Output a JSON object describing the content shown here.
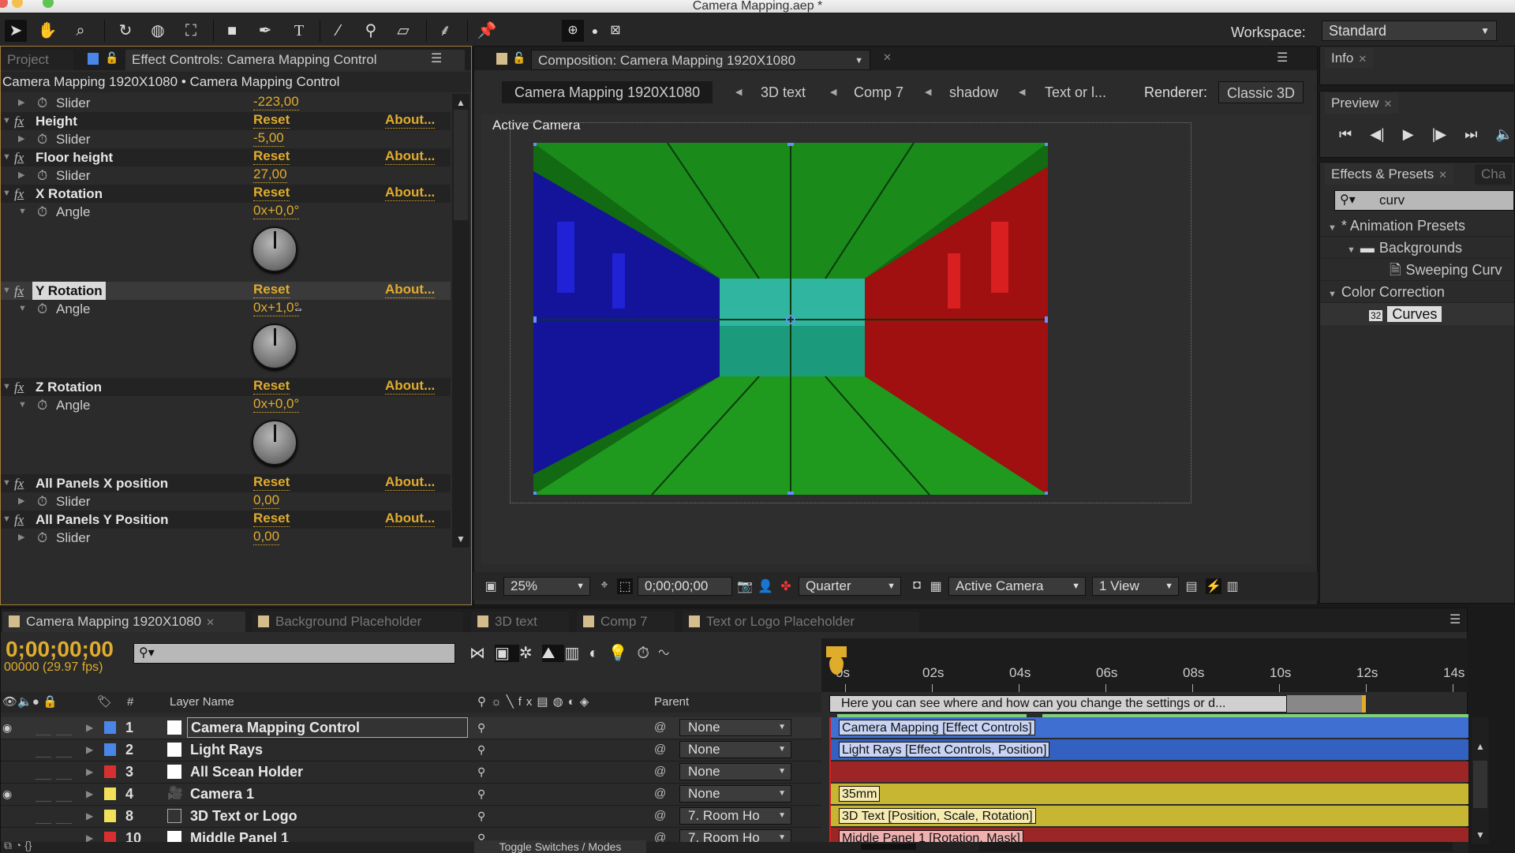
{
  "window": {
    "title": "Camera Mapping.aep *"
  },
  "toolbar": {
    "tools": [
      "selection-tool",
      "hand-tool",
      "zoom-tool",
      "rotation-tool",
      "orbit-camera-tool",
      "pan-behind-tool",
      "rectangle-tool",
      "pen-tool",
      "type-tool",
      "brush-tool",
      "clone-stamp-tool",
      "eraser-tool",
      "roto-brush-tool",
      "puppet-pin-tool"
    ],
    "workspace_label": "Workspace:",
    "workspace_value": "Standard"
  },
  "project_tab": "Project",
  "effect_controls": {
    "tab": "Effect Controls: Camera Mapping Control",
    "breadcrumb": "Camera Mapping 1920X1080 • Camera Mapping Control",
    "reset_label": "Reset",
    "about_label": "About...",
    "rows": [
      {
        "type": "param",
        "name": "Slider",
        "value": "-223,00"
      },
      {
        "type": "effect",
        "name": "Height"
      },
      {
        "type": "param",
        "name": "Slider",
        "value": "-5,00"
      },
      {
        "type": "effect",
        "name": "Floor height"
      },
      {
        "type": "param",
        "name": "Slider",
        "value": "27,00"
      },
      {
        "type": "effect",
        "name": "X Rotation"
      },
      {
        "type": "param",
        "name": "Angle",
        "value": "0x+0,0°"
      },
      {
        "type": "effect",
        "name": "Y Rotation"
      },
      {
        "type": "param",
        "name": "Angle",
        "value": "0x+1,0°"
      },
      {
        "type": "effect",
        "name": "Z Rotation"
      },
      {
        "type": "param",
        "name": "Angle",
        "value": "0x+0,0°"
      },
      {
        "type": "effect",
        "name": "All Panels X position"
      },
      {
        "type": "param",
        "name": "Slider",
        "value": "0,00"
      },
      {
        "type": "effect",
        "name": "All Panels Y Position"
      },
      {
        "type": "param",
        "name": "Slider",
        "value": "0,00"
      }
    ]
  },
  "composition": {
    "tab": "Composition: Camera Mapping 1920X1080",
    "breadcrumbs": [
      "Camera Mapping 1920X1080",
      "3D text",
      "Comp 7",
      "shadow",
      "Text or l..."
    ],
    "renderer_label": "Renderer:",
    "renderer_value": "Classic 3D",
    "view_label": "Active Camera",
    "zoom": "25%",
    "timecode": "0;00;00;00",
    "resolution": "Quarter",
    "camera": "Active Camera",
    "views": "1 View"
  },
  "info_panel": {
    "tab": "Info"
  },
  "preview_panel": {
    "tab": "Preview"
  },
  "effects_presets": {
    "tab": "Effects & Presets",
    "tab2": "Cha",
    "search_value": "curv",
    "tree": [
      {
        "label": "* Animation Presets",
        "level": 0,
        "kind": "group"
      },
      {
        "label": "Backgrounds",
        "level": 1,
        "kind": "folder"
      },
      {
        "label": "Sweeping Curv",
        "level": 2,
        "kind": "preset"
      },
      {
        "label": "Color Correction",
        "level": 0,
        "kind": "group"
      },
      {
        "label": "Curves",
        "level": 1,
        "kind": "effect",
        "selected": true
      }
    ]
  },
  "timeline": {
    "tabs": [
      "Camera Mapping 1920X1080",
      "Background Placeholder",
      "3D text",
      "Comp 7",
      "Text or Logo Placeholder"
    ],
    "timecode": "0;00;00;00",
    "frame_info": "00000 (29.97 fps)",
    "col_hash": "#",
    "col_layer_name": "Layer Name",
    "col_parent": "Parent",
    "ruler": [
      "0s",
      "02s",
      "04s",
      "06s",
      "08s",
      "10s",
      "12s",
      "14s"
    ],
    "comment_marker": "Here you can see where and how can you change the settings or d...",
    "toggle_label": "Toggle Switches / Modes",
    "layers": [
      {
        "idx": "1",
        "name": "Camera Mapping Control",
        "label_color": "#4a86e8",
        "parent": "None",
        "bar_label": "Camera Mapping [Effect Controls]",
        "bar_color": "#3f6fd1",
        "icon": "solid",
        "selected": true
      },
      {
        "idx": "2",
        "name": "Light Rays",
        "label_color": "#4a86e8",
        "parent": "None",
        "bar_label": "Light Rays [Effect Controls, Position]",
        "bar_color": "#3361c2",
        "icon": "solid"
      },
      {
        "idx": "3",
        "name": "All Scean Holder",
        "label_color": "#d83030",
        "parent": "None",
        "bar_label": "",
        "bar_color": "#9c2626",
        "icon": "solid"
      },
      {
        "idx": "4",
        "name": "Camera 1",
        "label_color": "#f2e05a",
        "parent": "None",
        "bar_label": "35mm",
        "bar_color": "#c7b632",
        "icon": "camera"
      },
      {
        "idx": "8",
        "name": "3D Text or Logo",
        "label_color": "#f2e05a",
        "parent": "7. Room Ho",
        "bar_label": "3D Text [Position, Scale, Rotation]",
        "bar_color": "#c7b632",
        "icon": "comp"
      },
      {
        "idx": "10",
        "name": "Middle Panel 1",
        "label_color": "#d83030",
        "parent": "7. Room Ho",
        "bar_label": "Middle Panel 1 [Rotation, Mask]",
        "bar_color": "#9c2626",
        "icon": "solid"
      }
    ]
  },
  "colors": {
    "accent": "#e0ac2c",
    "panel_bg": "#2b2b2b",
    "wall_left": "#1414a0",
    "wall_right": "#a01010",
    "floor": "#1e8a1e",
    "back": "#2fb5a0"
  }
}
